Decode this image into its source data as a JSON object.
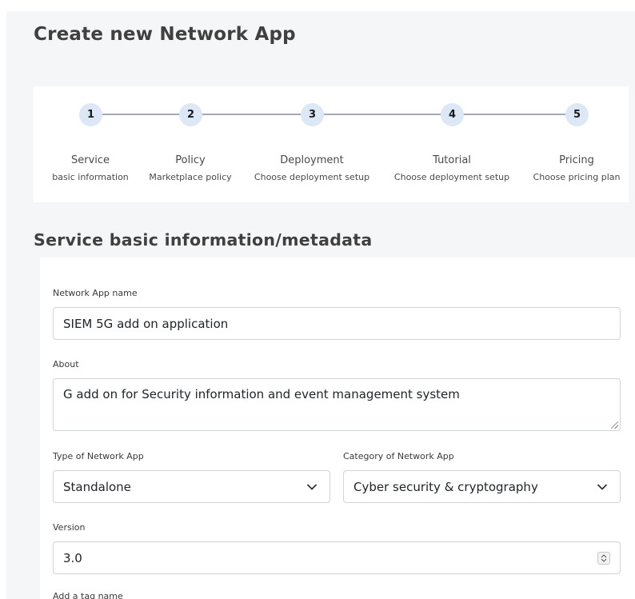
{
  "page": {
    "title": "Create new Network App",
    "section_title": "Service basic information/metadata"
  },
  "stepper": {
    "steps": [
      {
        "number": "1",
        "title": "Service",
        "subtitle": "basic information"
      },
      {
        "number": "2",
        "title": "Policy",
        "subtitle": "Marketplace policy"
      },
      {
        "number": "3",
        "title": "Deployment",
        "subtitle": "Choose deployment setup"
      },
      {
        "number": "4",
        "title": "Tutorial",
        "subtitle": "Choose deployment setup"
      },
      {
        "number": "5",
        "title": "Pricing",
        "subtitle": "Choose pricing plan"
      }
    ]
  },
  "form": {
    "name_label": "Network App name",
    "name_value": "SIEM 5G add on application",
    "about_label": "About",
    "about_value": "G add on for Security information and event management system",
    "type_label": "Type of Network App",
    "type_value": "Standalone",
    "category_label": "Category of Network App",
    "category_value": "Cyber security & cryptography",
    "version_label": "Version",
    "version_value": "3.0",
    "tag_label": "Add a tag name"
  },
  "colors": {
    "step_circle_bg": "#dde8f6",
    "step_line": "#a6aab0",
    "page_bg": "#f5f6f8"
  }
}
